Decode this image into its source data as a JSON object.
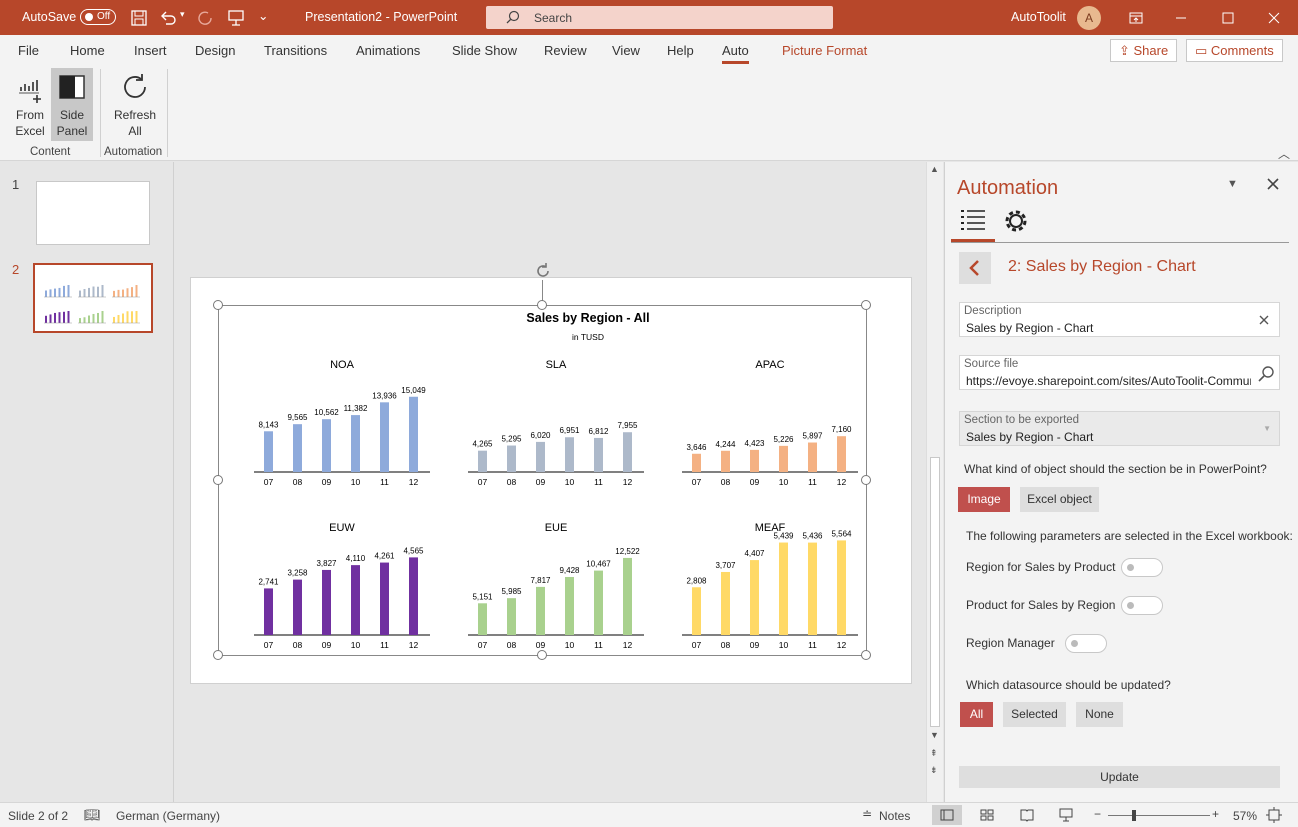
{
  "titlebar": {
    "autosave_label": "AutoSave",
    "autosave_state": "Off",
    "doc_title": "Presentation2 - PowerPoint",
    "search_placeholder": "Search",
    "account_name": "AutoToolit",
    "avatar_initial": "A"
  },
  "tabs": [
    "File",
    "Home",
    "Insert",
    "Design",
    "Transitions",
    "Animations",
    "Slide Show",
    "Review",
    "View",
    "Help",
    "Auto",
    "Picture Format"
  ],
  "active_tab": "Auto",
  "share_label": "Share",
  "comments_label": "Comments",
  "ribbon": {
    "from_excel": [
      "From",
      "Excel"
    ],
    "side_panel": [
      "Side",
      "Panel"
    ],
    "refresh_all": [
      "Refresh",
      "All"
    ],
    "group_content": "Content",
    "group_automation": "Automation"
  },
  "thumbs": [
    {
      "num": "1"
    },
    {
      "num": "2"
    }
  ],
  "chart": {
    "title": "Sales by Region - All",
    "subtitle": "in TUSD"
  },
  "chart_data": {
    "type": "bar",
    "title": "Sales by Region - All",
    "subtitle": "in TUSD",
    "categories": [
      "07",
      "08",
      "09",
      "10",
      "11",
      "12"
    ],
    "panels": [
      {
        "name": "NOA",
        "color": "#8eaadb",
        "values": [
          8143,
          9565,
          10562,
          11382,
          13936,
          15049
        ],
        "labels": [
          "8,143",
          "9,565",
          "10,562",
          "11,382",
          "13,936",
          "15,049"
        ]
      },
      {
        "name": "SLA",
        "color": "#adb9ca",
        "values": [
          4265,
          5295,
          6020,
          6951,
          6812,
          7955
        ],
        "labels": [
          "4,265",
          "5,295",
          "6,020",
          "6,951",
          "6,812",
          "7,955"
        ]
      },
      {
        "name": "APAC",
        "color": "#f4b183",
        "values": [
          3646,
          4244,
          4423,
          5226,
          5897,
          7160
        ],
        "labels": [
          "3,646",
          "4,244",
          "4,423",
          "5,226",
          "5,897",
          "7,160"
        ]
      },
      {
        "name": "EUW",
        "color": "#7030a0",
        "values": [
          2741,
          3258,
          3827,
          4110,
          4261,
          4565
        ],
        "labels": [
          "2,741",
          "3,258",
          "3,827",
          "4,110",
          "4,261",
          "4,565"
        ]
      },
      {
        "name": "EUE",
        "color": "#a9d18e",
        "values": [
          5151,
          5985,
          7817,
          9428,
          10467,
          12522
        ],
        "labels": [
          "5,151",
          "5,985",
          "7,817",
          "9,428",
          "10,467",
          "12,522"
        ]
      },
      {
        "name": "MEAF",
        "color": "#ffd966",
        "values": [
          2808,
          3707,
          4407,
          5439,
          5436,
          5564
        ],
        "labels": [
          "2,808",
          "3,707",
          "4,407",
          "5,439",
          "5,436",
          "5,564"
        ]
      }
    ]
  },
  "pane": {
    "title": "Automation",
    "section_title": "2: Sales by Region - Chart",
    "description_label": "Description",
    "description_value": "Sales by Region - Chart",
    "source_label": "Source file",
    "source_value": "https://evoye.sharepoint.com/sites/AutoToolit-CommunityT",
    "section_label": "Section to be exported",
    "section_value": "Sales by Region - Chart",
    "object_question": "What kind of object should the section be in PowerPoint?",
    "object_options": [
      "Image",
      "Excel object"
    ],
    "params_text": "The following parameters are selected in the Excel workbook:",
    "params": [
      "Region for Sales by Product",
      "Product for Sales by Region",
      "Region Manager"
    ],
    "datasource_question": "Which datasource should be updated?",
    "datasource_options": [
      "All",
      "Selected",
      "None"
    ],
    "update_label": "Update"
  },
  "status": {
    "slide": "Slide 2 of 2",
    "language": "German (Germany)",
    "notes": "Notes",
    "zoom": "57%"
  },
  "colors": {
    "accent": "#b7472a",
    "button_on": "#c0504d"
  }
}
